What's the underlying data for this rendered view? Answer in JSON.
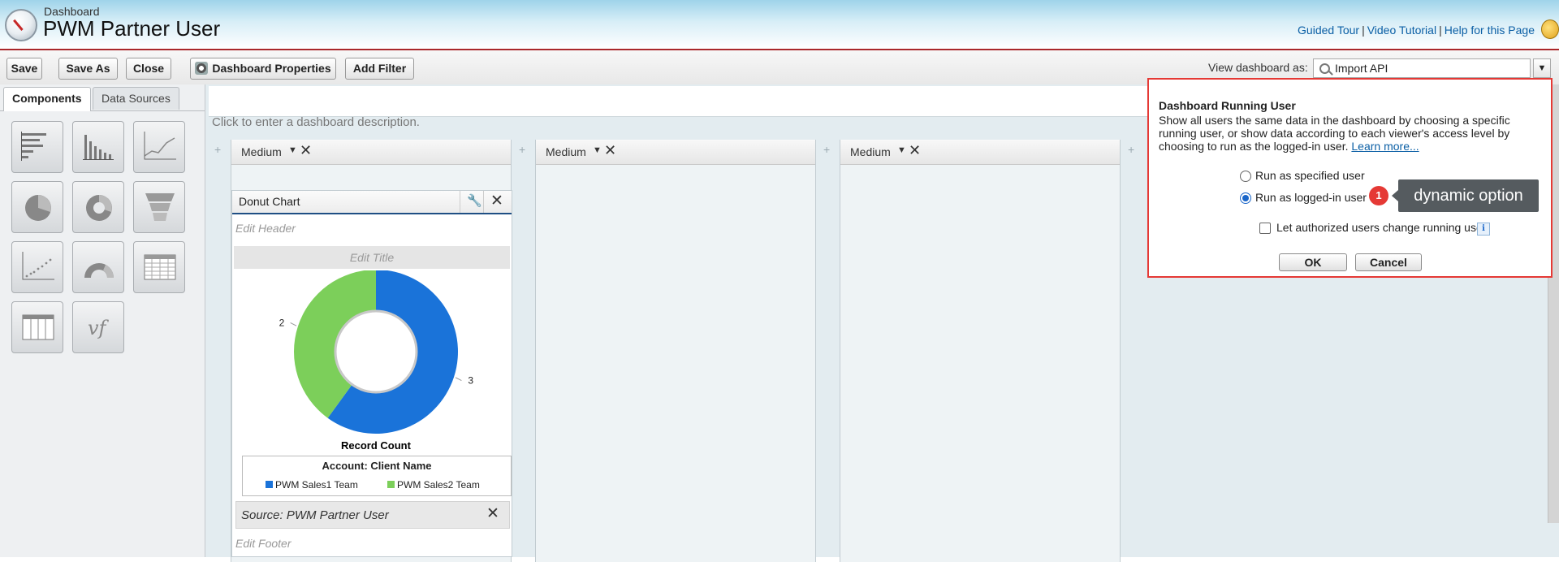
{
  "header": {
    "breadcrumb": "Dashboard",
    "title": "PWM Partner User",
    "links": [
      "Guided Tour",
      "Video Tutorial",
      "Help for this Page"
    ],
    "separator": "|"
  },
  "toolbar": {
    "save": "Save",
    "save_as": "Save As",
    "close": "Close",
    "dashboard_properties": "Dashboard Properties",
    "add_filter": "Add Filter",
    "view_as_label": "View dashboard as:",
    "view_as_value": "Import API"
  },
  "left_panel": {
    "tabs": [
      "Components",
      "Data Sources"
    ],
    "active_tab": "Components",
    "components": [
      "horizontal-bar-chart",
      "vertical-bar-chart",
      "line-chart",
      "pie-chart",
      "donut-chart",
      "funnel-chart",
      "scatter-chart",
      "gauge",
      "metric-table",
      "table",
      "visualforce-page"
    ],
    "vf_label": "vf"
  },
  "canvas": {
    "description_placeholder": "Click to enter a dashboard description.",
    "columns": [
      {
        "width_label": "Medium"
      },
      {
        "width_label": "Medium"
      },
      {
        "width_label": "Medium"
      }
    ],
    "component": {
      "title": "Donut Chart",
      "edit_header": "Edit Header",
      "edit_title": "Edit Title",
      "edit_footer": "Edit Footer",
      "source": "Source: PWM Partner User",
      "legend_title": "Account: Client Name",
      "center_label": "Record Count"
    }
  },
  "chart_data": {
    "type": "pie",
    "subtype": "donut",
    "title": "",
    "legend_title": "Account: Client Name",
    "value_label": "Record Count",
    "categories": [
      "PWM Sales1 Team",
      "PWM Sales2 Team"
    ],
    "values": [
      3,
      2
    ],
    "colors": [
      "#1a73d9",
      "#7ccf5a"
    ],
    "legend_position": "bottom"
  },
  "popup": {
    "title": "Dashboard Running User",
    "body": "Show all users the same data in the dashboard by choosing a specific running user, or show data according to each viewer's access level by choosing to run as the logged-in user.",
    "learn_more": "Learn more...",
    "option_specified": "Run as specified user",
    "option_logged_in": "Run as logged-in user",
    "selected_option": "logged-in",
    "allow_change": "Let authorized users change running user",
    "allow_change_checked": false,
    "ok": "OK",
    "cancel": "Cancel"
  },
  "annotation": {
    "badge": "1",
    "tooltip": "dynamic option",
    "color": "#e53935"
  },
  "colors": {
    "header_border": "#a9272a",
    "link": "#0b5fa5",
    "canvas_bg": "#e3ecf0"
  }
}
